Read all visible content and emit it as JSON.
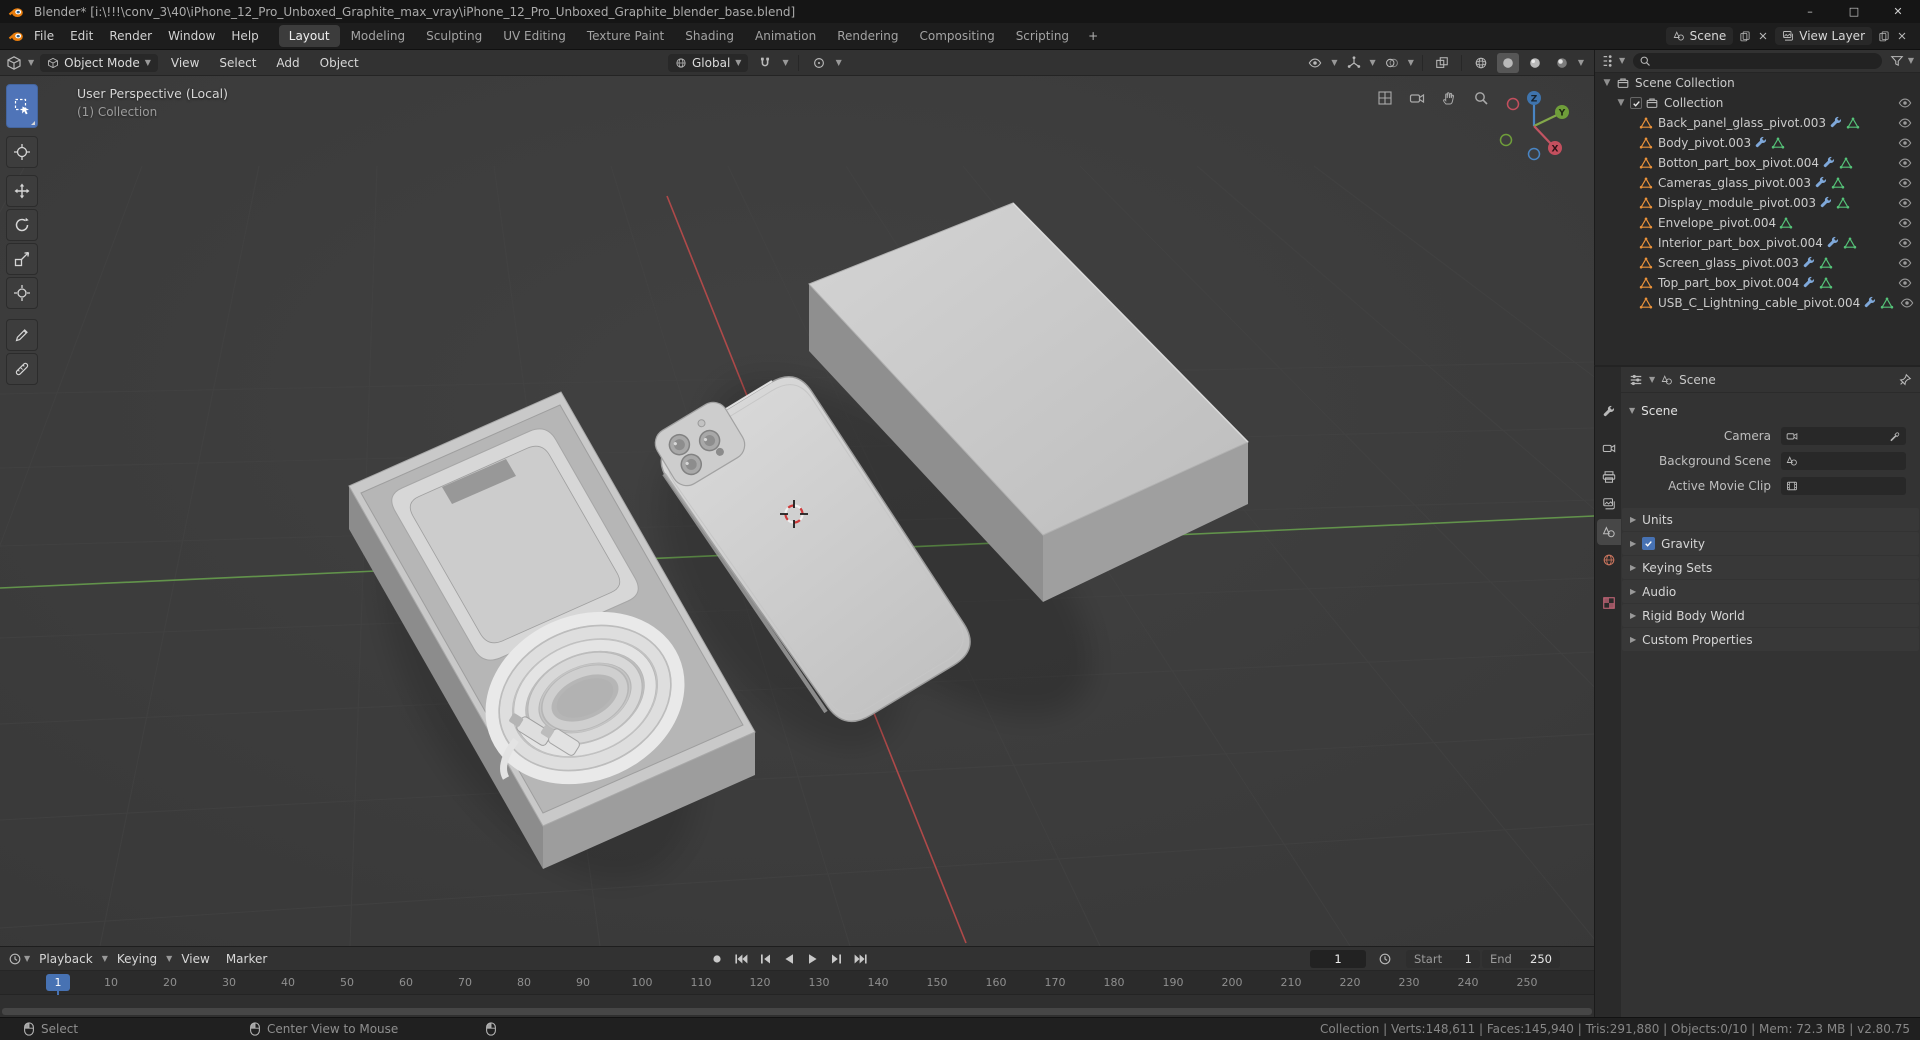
{
  "titlebar": {
    "title": "Blender* [i:\\!!!\\conv_3\\40\\iPhone_12_Pro_Unboxed_Graphite_max_vray\\iPhone_12_Pro_Unboxed_Graphite_blender_base.blend]",
    "window_controls": {
      "minimize": "–",
      "maximize": "□",
      "close": "✕"
    }
  },
  "menubar": {
    "menus": [
      "File",
      "Edit",
      "Render",
      "Window",
      "Help"
    ],
    "workspaces": [
      "Layout",
      "Modeling",
      "Sculpting",
      "UV Editing",
      "Texture Paint",
      "Shading",
      "Animation",
      "Rendering",
      "Compositing",
      "Scripting"
    ],
    "active_workspace": "Layout",
    "add_workspace": "+",
    "scene_selector": {
      "label": "Scene"
    },
    "view_layer_selector": {
      "label": "View Layer"
    }
  },
  "viewport": {
    "header": {
      "mode": "Object Mode",
      "menus": [
        "View",
        "Select",
        "Add",
        "Object"
      ],
      "orientation": "Global"
    },
    "overlay": {
      "line1": "User Perspective (Local)",
      "line2": "(1) Collection"
    },
    "gizmo": {
      "x": "X",
      "y": "Y",
      "z": "Z"
    }
  },
  "outliner": {
    "search_placeholder": "",
    "root": "Scene Collection",
    "collection": "Collection",
    "items": [
      {
        "name": "Back_panel_glass_pivot.003"
      },
      {
        "name": "Body_pivot.003"
      },
      {
        "name": "Botton_part_box_pivot.004"
      },
      {
        "name": "Cameras_glass_pivot.003"
      },
      {
        "name": "Display_module_pivot.003"
      },
      {
        "name": "Envelope_pivot.004"
      },
      {
        "name": "Interior_part_box_pivot.004"
      },
      {
        "name": "Screen_glass_pivot.003"
      },
      {
        "name": "Top_part_box_pivot.004"
      },
      {
        "name": "USB_C_Lightning_cable_pivot.004"
      }
    ]
  },
  "properties": {
    "breadcrumb": "Scene",
    "panel_title": "Scene",
    "fields": [
      {
        "label": "Camera"
      },
      {
        "label": "Background Scene"
      },
      {
        "label": "Active Movie Clip"
      }
    ],
    "sections": [
      {
        "label": "Units"
      },
      {
        "label": "Gravity",
        "checked": true
      },
      {
        "label": "Keying Sets"
      },
      {
        "label": "Audio"
      },
      {
        "label": "Rigid Body World"
      },
      {
        "label": "Custom Properties"
      }
    ]
  },
  "timeline": {
    "menus": [
      "Playback",
      "Keying",
      "View",
      "Marker"
    ],
    "current_frame": "1",
    "playhead_frame": "1",
    "start_label": "Start",
    "start_value": "1",
    "end_label": "End",
    "end_value": "250",
    "ticks": [
      "10",
      "20",
      "30",
      "40",
      "50",
      "60",
      "70",
      "80",
      "90",
      "100",
      "110",
      "120",
      "130",
      "140",
      "150",
      "160",
      "170",
      "180",
      "190",
      "200",
      "210",
      "220",
      "230",
      "240",
      "250"
    ]
  },
  "statusbar": {
    "left": "Select",
    "hint": "Center View to Mouse",
    "stats": "Collection | Verts:148,611 | Faces:145,940 | Tris:291,880 | Objects:0/10 | Mem: 72.3 MB | v2.80.75"
  },
  "colors": {
    "accent": "#4772b3",
    "object_icon": "#e8913a",
    "mesh_data_icon": "#55c278",
    "modifier_icon": "#7fa8d9",
    "axis_x": "#bc4b4b",
    "axis_y": "#69a34e",
    "axis_z": "#3f74ad",
    "viewport_background": "#3b3b3b"
  }
}
